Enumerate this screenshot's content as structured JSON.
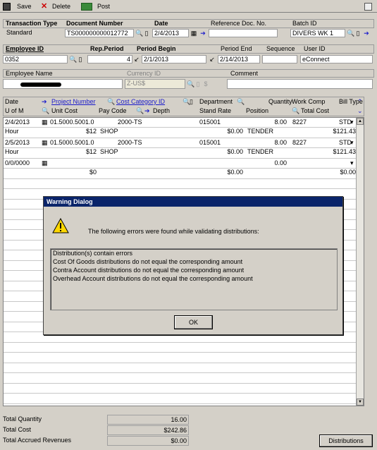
{
  "toolbar": {
    "save": "Save",
    "delete": "Delete",
    "post": "Post"
  },
  "header": {
    "transaction_type_label": "Transaction Type",
    "transaction_type": "Standard",
    "document_number_label": "Document Number",
    "document_number": "TS000000000012772",
    "date_label": "Date",
    "date": "2/4/2013",
    "reference_doc_label": "Reference Doc. No.",
    "batch_id_label": "Batch ID",
    "batch_id": "DIVERS WK 1",
    "employee_id_label": "Employee ID",
    "employee_id": "0352",
    "rep_period_label": "Rep.Period",
    "rep_period": "4",
    "period_begin_label": "Period Begin",
    "period_begin": "2/1/2013",
    "period_end_label": "Period End",
    "period_end": "2/14/2013",
    "sequence_label": "Sequence",
    "user_id_label": "User ID",
    "user_id": "eConnect",
    "employee_name_label": "Employee Name",
    "currency_id_label": "Currency ID",
    "currency_id": "Z-US$",
    "comment_label": "Comment"
  },
  "grid": {
    "h1": [
      "Date",
      "Project Number",
      "Cost Category ID",
      "Department",
      "Quantity",
      "Work Comp",
      "Bill Type"
    ],
    "h2": [
      "U of M",
      "Unit Cost",
      "Pay Code",
      "Depth",
      "Stand Rate",
      "Position",
      "Total Cost"
    ],
    "rows": [
      {
        "date": "2/4/2013",
        "project": "01.5000.5001.0",
        "cost_cat": "2000-TS",
        "dept": "015001",
        "qty": "8.00",
        "work_comp": "8227",
        "bill": "STD",
        "uom": "Hour",
        "unit_cost": "$12",
        "pay_code": "SHOP",
        "stand_rate": "$0.00",
        "position": "TENDER",
        "total": "$121.43"
      },
      {
        "date": "2/5/2013",
        "project": "01.5000.5001.0",
        "cost_cat": "2000-TS",
        "dept": "015001",
        "qty": "8.00",
        "work_comp": "8227",
        "bill": "STD",
        "uom": "Hour",
        "unit_cost": "$12",
        "pay_code": "SHOP",
        "stand_rate": "$0.00",
        "position": "TENDER",
        "total": "$121.43"
      },
      {
        "date": "0/0/0000",
        "project": "",
        "cost_cat": "",
        "dept": "",
        "qty": "0.00",
        "work_comp": "",
        "bill": "",
        "uom": "",
        "unit_cost": "$0",
        "pay_code": "",
        "stand_rate": "$0.00",
        "position": "",
        "total": "$0.00"
      }
    ]
  },
  "dialog": {
    "title": "Warning Dialog",
    "message": "The following errors were found while validating distributions:",
    "errors": [
      "Distribution(s) contain errors",
      "Cost Of Goods distributions do not equal the corresponding amount",
      "Contra Account distributions do not equal the corresponding amount",
      "Overhead Account distributions do not equal the corresponding amount"
    ],
    "ok": "OK"
  },
  "totals": {
    "quantity_label": "Total Quantity",
    "quantity": "16.00",
    "cost_label": "Total Cost",
    "cost": "$242.86",
    "revenue_label": "Total Accrued Revenues",
    "revenue": "$0.00"
  },
  "distributions_button": "Distributions"
}
